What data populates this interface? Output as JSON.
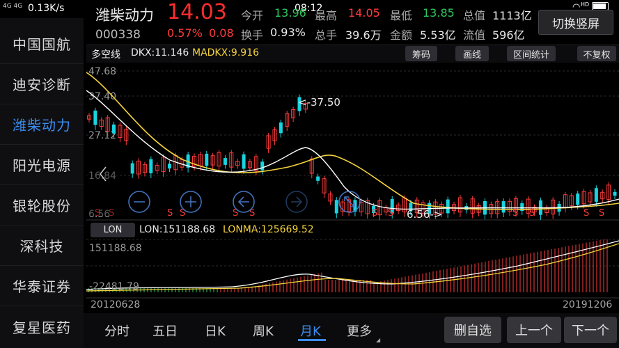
{
  "status_bar": {
    "network": "4G 4G",
    "speed": "0.13K/s",
    "time": "08:12",
    "hd": "HD"
  },
  "sidebar": {
    "items": [
      {
        "label": "中国国航",
        "active": false
      },
      {
        "label": "迪安诊断",
        "active": false
      },
      {
        "label": "潍柴动力",
        "active": true
      },
      {
        "label": "阳光电源",
        "active": false
      },
      {
        "label": "银轮股份",
        "active": false
      },
      {
        "label": "深科技",
        "active": false
      },
      {
        "label": "华泰证券",
        "active": false
      },
      {
        "label": "复星医药",
        "active": false
      }
    ]
  },
  "stock": {
    "name": "潍柴动力",
    "code": "000338",
    "price": "14.03",
    "change_pct": "0.57%",
    "change_abs": "0.08"
  },
  "quote": {
    "open_label": "今开",
    "open": "13.96",
    "high_label": "最高",
    "high": "14.05",
    "low_label": "最低",
    "low": "13.85",
    "total_cap_label": "总值",
    "total_cap": "1113亿",
    "turnover_label": "换手",
    "turnover": "0.93%",
    "volume_label": "总手",
    "volume": "39.6万",
    "amount_label": "金额",
    "amount": "5.53亿",
    "float_cap_label": "流值",
    "float_cap": "596亿"
  },
  "switch_button": "切换竖屏",
  "main_chart": {
    "indicator_name": "多空线",
    "dkx": "DKX:11.146",
    "madkx": "MADKX:9.916",
    "toolbar": [
      "筹码",
      "画线",
      "区间统计",
      "不复权"
    ],
    "y_ticks": [
      "47.68",
      "37.40",
      "27.12",
      "16.84",
      "6.56"
    ],
    "max_annotation": "<-37.50",
    "min_annotation": "6.56->",
    "signal_char": "S"
  },
  "sub_chart": {
    "button": "LON",
    "lon": "LON:151188.68",
    "lonma": "LONMA:125669.52",
    "y_top": "151188.68",
    "y_bottom": "-22481.79",
    "date_start": "20120628",
    "date_end": "20191206"
  },
  "tabs": [
    {
      "label": "分时",
      "active": false
    },
    {
      "label": "五日",
      "active": false
    },
    {
      "label": "日K",
      "active": false
    },
    {
      "label": "周K",
      "active": false
    },
    {
      "label": "月K",
      "active": true
    },
    {
      "label": "更多",
      "active": false
    }
  ],
  "actions": [
    "删自选",
    "上一个",
    "下一个"
  ],
  "colors": {
    "up": "#ff3b3b",
    "down": "#19d3e0",
    "dkx_line": "#ffffff",
    "madkx_line": "#f4d33c",
    "active": "#3c8df0"
  },
  "chart_data": {
    "type": "candlestick",
    "timeframe": "monthly",
    "x_range": [
      "20120628",
      "20191206"
    ],
    "y_range": [
      6.56,
      47.68
    ],
    "y_ticks": [
      47.68,
      37.4,
      27.12,
      16.84,
      6.56
    ],
    "annotations": {
      "max": 37.5,
      "min": 6.56
    },
    "legend": {
      "DKX": 11.146,
      "MADKX": 9.916
    },
    "sub_indicator": {
      "name": "LON",
      "LON": 151188.68,
      "LONMA": 125669.52,
      "y_range": [
        -22481.79,
        151188.68
      ]
    }
  }
}
